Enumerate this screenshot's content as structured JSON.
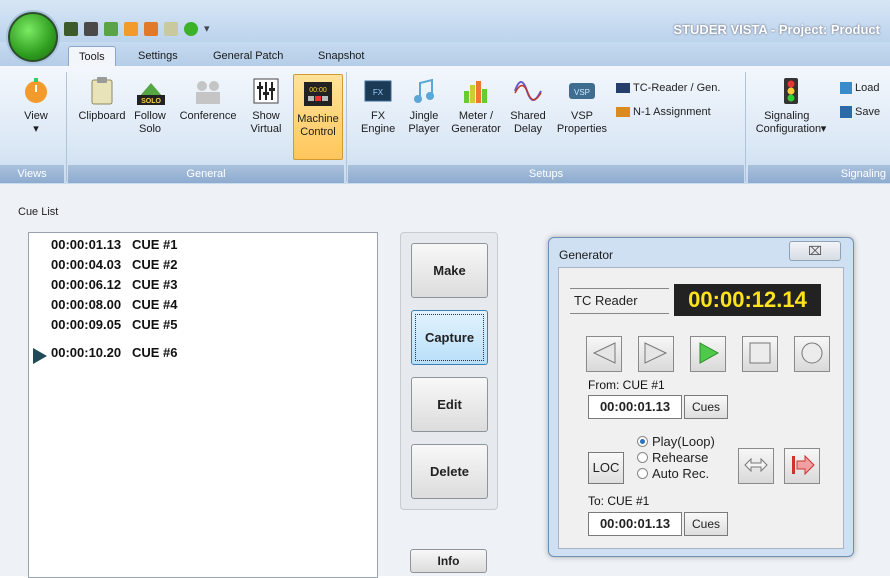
{
  "window": {
    "title": "STUDER VISTA - Project: Product"
  },
  "tabs": [
    "Tools",
    "Settings",
    "General Patch",
    "Snapshot"
  ],
  "ribbon": {
    "buttons": [
      {
        "label": "View",
        "icon": "timer-icon"
      },
      {
        "label": "Clipboard",
        "icon": "clipboard-icon"
      },
      {
        "label": "Follow Solo",
        "icon": "follow-solo-icon"
      },
      {
        "label": "Conference",
        "icon": "conference-icon"
      },
      {
        "label": "Show Virtual",
        "icon": "faders-icon"
      },
      {
        "label": "Machine Control",
        "icon": "machine-control-icon"
      },
      {
        "label": "FX Engine",
        "icon": "fx-engine-icon"
      },
      {
        "label": "Jingle Player",
        "icon": "music-note-icon"
      },
      {
        "label": "Meter / Generator",
        "icon": "meter-icon"
      },
      {
        "label": "Shared Delay",
        "icon": "wave-icon"
      },
      {
        "label": "VSP Properties",
        "icon": "vsp-icon"
      },
      {
        "label": "TC-Reader / Gen.",
        "icon": "tc-reader-icon"
      },
      {
        "label": "N-1 Assignment",
        "icon": "n-1-icon"
      },
      {
        "label": "Signaling Configuration",
        "icon": "signaling-icon"
      },
      {
        "label": "Load",
        "icon": "load-icon"
      },
      {
        "label": "Save",
        "icon": "save-icon"
      }
    ],
    "groups": [
      "Views",
      "General",
      "Setups",
      "Signaling"
    ]
  },
  "cue_list": {
    "label": "Cue List",
    "rows": [
      {
        "time": "00:00:01.13",
        "name": "CUE #1"
      },
      {
        "time": "00:00:04.03",
        "name": "CUE #2"
      },
      {
        "time": "00:00:06.12",
        "name": "CUE #3"
      },
      {
        "time": "00:00:08.00",
        "name": "CUE #4"
      },
      {
        "time": "00:00:09.05",
        "name": "CUE #5"
      },
      {
        "time": "00:00:10.20",
        "name": "CUE #6"
      }
    ]
  },
  "actions": {
    "make": "Make",
    "capture": "Capture",
    "edit": "Edit",
    "delete": "Delete",
    "info": "Info"
  },
  "generator": {
    "title": "Generator",
    "close": "⌧",
    "tc_reader_label": "TC Reader",
    "tc_value": "00:00:12.14",
    "from_label": "From: CUE #1",
    "from_time": "00:00:01.13",
    "to_label": "To: CUE #1",
    "to_time": "00:00:01.13",
    "cues_label": "Cues",
    "loc_label": "LOC",
    "modes": [
      "Play(Loop)",
      "Rehearse",
      "Auto Rec."
    ],
    "selected_mode": "Play(Loop)"
  },
  "colors": {
    "accent": "#ffe21c",
    "ribbon_group": "#8eabcf"
  }
}
